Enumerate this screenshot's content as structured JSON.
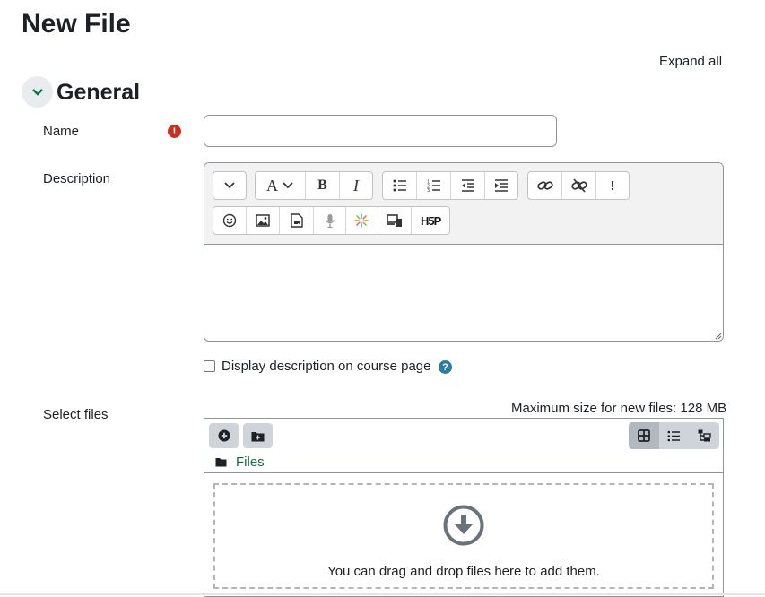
{
  "page": {
    "title": "New File",
    "expand_all": "Expand all"
  },
  "section": {
    "title": "General"
  },
  "fields": {
    "name": {
      "label": "Name",
      "value": "",
      "placeholder": "",
      "required_icon": "exclamation-icon"
    },
    "description": {
      "label": "Description"
    },
    "display_description": {
      "label": "Display description on course page",
      "checked": false
    },
    "select_files": {
      "label": "Select files",
      "max_size": "Maximum size for new files: 128 MB"
    }
  },
  "editor": {
    "row1": [
      [
        "collapse-toolbar-icon"
      ],
      [
        "font-style-icon",
        "bold-icon",
        "italic-icon"
      ],
      [
        "unordered-list-icon",
        "ordered-list-icon",
        "outdent-icon",
        "indent-icon"
      ],
      [
        "link-icon",
        "unlink-icon",
        "accessibility-checker-icon"
      ]
    ],
    "row2": [
      "emoji-icon",
      "image-icon",
      "media-icon",
      "record-audio-icon",
      "record-video-icon",
      "manage-files-icon",
      "h5p-icon"
    ],
    "bold": "B",
    "italic": "I",
    "font": "A",
    "h5p": "H5P",
    "exclaim": "!",
    "content": ""
  },
  "filemanager": {
    "path": "Files",
    "drop_text": "You can drag and drop files here to add them.",
    "active_view": "icons"
  }
}
